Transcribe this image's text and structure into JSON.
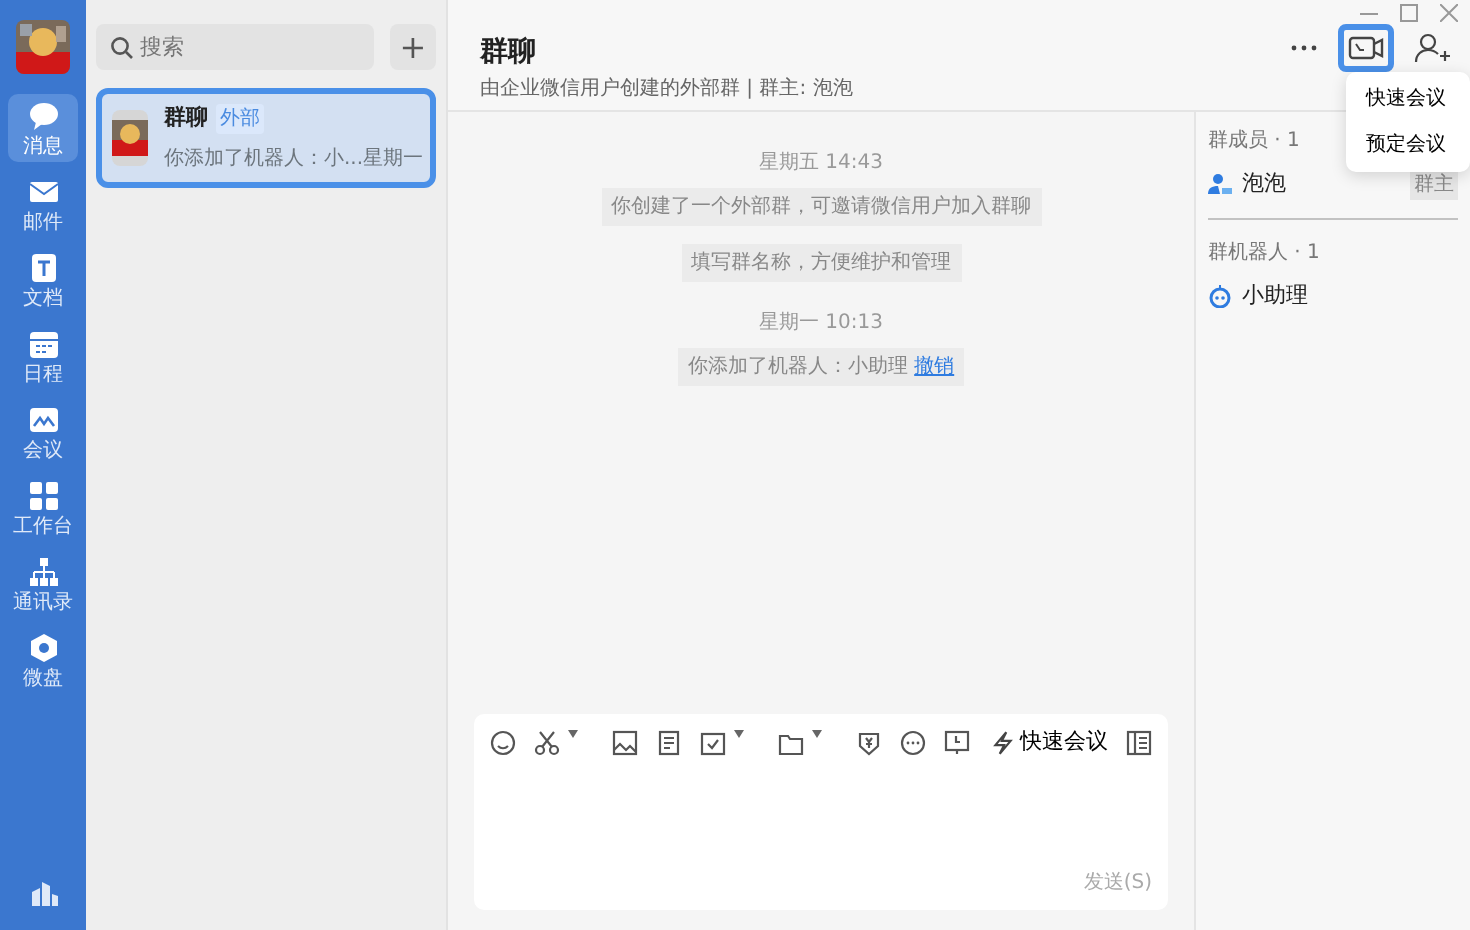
{
  "nav": [
    {
      "label": "消息",
      "selected": true
    },
    {
      "label": "邮件",
      "selected": false
    },
    {
      "label": "文档",
      "selected": false
    },
    {
      "label": "日程",
      "selected": false
    },
    {
      "label": "会议",
      "selected": false
    },
    {
      "label": "工作台",
      "selected": false
    },
    {
      "label": "通讯录",
      "selected": false
    },
    {
      "label": "微盘",
      "selected": false
    }
  ],
  "search": {
    "placeholder": "搜索"
  },
  "add_button": "+",
  "conversations": [
    {
      "name": "群聊",
      "tag": "外部",
      "preview": "你添加了机器人：小...",
      "time": "星期一",
      "selected": true
    }
  ],
  "chat": {
    "title": "群聊",
    "subtitle": "由企业微信用户创建的外部群 | 群主: 泡泡",
    "video_call_highlighted": true
  },
  "messages": [
    {
      "kind": "time",
      "text": "星期五 14:43"
    },
    {
      "kind": "notice",
      "text": "你创建了一个外部群，可邀请微信用户加入群聊"
    },
    {
      "kind": "notice",
      "text": "填写群名称，方便维护和管理"
    },
    {
      "kind": "time",
      "text": "星期一 10:13"
    },
    {
      "kind": "notice",
      "text": "你添加了机器人：小助理",
      "link": "撤销"
    }
  ],
  "composer": {
    "quick_meeting": "快速会议",
    "send": "发送(S)"
  },
  "members": {
    "title": "群成员 · 1",
    "items": [
      {
        "name": "泡泡",
        "role": "群主"
      }
    ]
  },
  "bots": {
    "title": "群机器人 · 1",
    "items": [
      {
        "name": "小助理"
      }
    ]
  },
  "menu": {
    "items": [
      "快速会议",
      "预定会议"
    ]
  }
}
